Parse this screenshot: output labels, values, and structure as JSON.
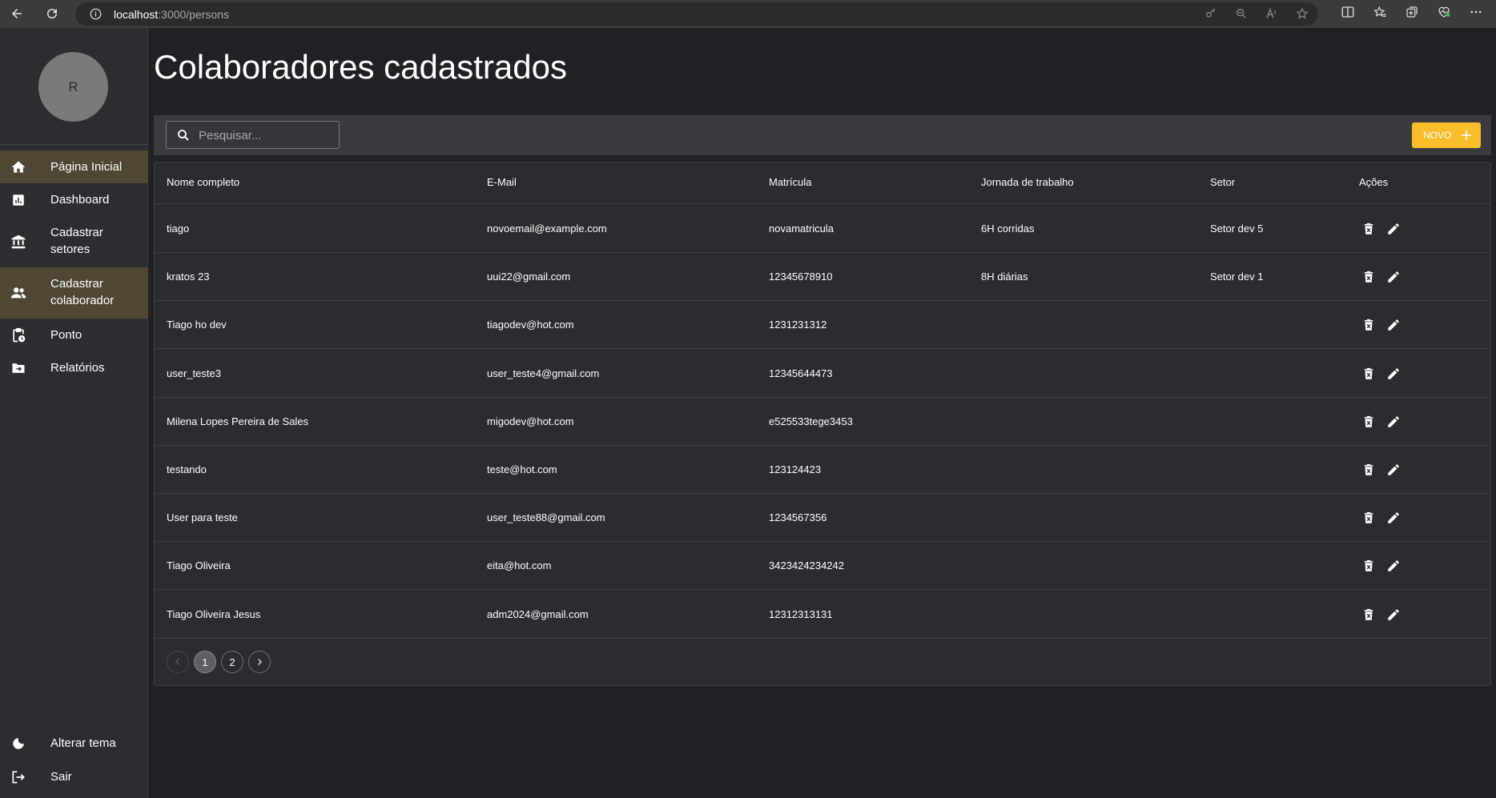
{
  "browser": {
    "url_host": "localhost",
    "url_rest": ":3000/persons"
  },
  "sidebar": {
    "avatar_initial": "R",
    "items": [
      {
        "label": "Página Inicial",
        "icon": "home-icon",
        "active": true
      },
      {
        "label": "Dashboard",
        "icon": "chart-icon",
        "active": false
      },
      {
        "label": "Cadastrar setores",
        "icon": "bank-icon",
        "active": false
      },
      {
        "label": "Cadastrar colaborador",
        "icon": "people-icon",
        "active": true
      },
      {
        "label": "Ponto",
        "icon": "clipboard-clock-icon",
        "active": false
      },
      {
        "label": "Relatórios",
        "icon": "folder-arrow-icon",
        "active": false
      }
    ],
    "bottom": [
      {
        "label": "Alterar tema",
        "icon": "moon-icon"
      },
      {
        "label": "Sair",
        "icon": "logout-icon"
      }
    ]
  },
  "main": {
    "title": "Colaboradores cadastrados",
    "search_placeholder": "Pesquisar...",
    "new_button": "NOVO",
    "accent_color": "#f9bd2b",
    "columns": [
      "Nome completo",
      "E-Mail",
      "Matrícula",
      "Jornada de trabalho",
      "Setor",
      "Ações"
    ],
    "rows": [
      [
        "tiago",
        "novoemail@example.com",
        "novamatricula",
        "6H corridas",
        "Setor dev 5"
      ],
      [
        "kratos 23",
        "uui22@gmail.com",
        "12345678910",
        "8H diárias",
        "Setor dev 1"
      ],
      [
        "Tiago ho dev",
        "tiagodev@hot.com",
        "1231231312",
        "",
        ""
      ],
      [
        "user_teste3",
        "user_teste4@gmail.com",
        "12345644473",
        "",
        ""
      ],
      [
        "Milena Lopes Pereira de Sales",
        "migodev@hot.com",
        "e525533tege3453",
        "",
        ""
      ],
      [
        "testando",
        "teste@hot.com",
        "123124423",
        "",
        ""
      ],
      [
        "User para teste",
        "user_teste88@gmail.com",
        "1234567356",
        "",
        ""
      ],
      [
        "Tiago Oliveira",
        "eita@hot.com",
        "3423424234242",
        "",
        ""
      ],
      [
        "Tiago Oliveira Jesus",
        "adm2024@gmail.com",
        "12312313131",
        "",
        ""
      ]
    ],
    "pagination": {
      "pages": [
        "1",
        "2"
      ],
      "current": "1"
    }
  }
}
